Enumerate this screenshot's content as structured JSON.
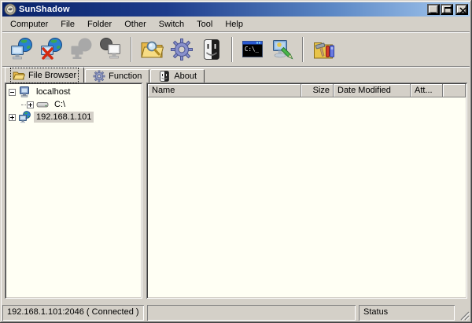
{
  "window": {
    "title": "SunShadow"
  },
  "titlebar_controls": [
    {
      "name": "minimize",
      "icon": "minimize-icon"
    },
    {
      "name": "maximize",
      "icon": "maximize-icon"
    },
    {
      "name": "close",
      "icon": "close-icon"
    }
  ],
  "menu": {
    "items": [
      "Computer",
      "File",
      "Folder",
      "Other",
      "Switch",
      "Tool",
      "Help"
    ]
  },
  "toolbar": {
    "buttons": [
      {
        "icon": "connect-icon"
      },
      {
        "icon": "disconnect-icon"
      },
      {
        "icon": "connect-disabled-icon",
        "disabled": true
      },
      {
        "icon": "computer-gray-icon",
        "disabled": true
      },
      {
        "icon": "separator"
      },
      {
        "icon": "folder-search-icon"
      },
      {
        "icon": "gear-icon"
      },
      {
        "icon": "finder-icon"
      },
      {
        "icon": "separator"
      },
      {
        "icon": "terminal-icon"
      },
      {
        "icon": "remote-edit-icon"
      },
      {
        "icon": "separator"
      },
      {
        "icon": "toolbox-icon"
      }
    ]
  },
  "tabs": [
    {
      "label": "File Browser",
      "icon": "folder-open-icon",
      "active": true
    },
    {
      "label": "Function",
      "icon": "gear-small-icon",
      "active": false
    },
    {
      "label": "About",
      "icon": "finder-small-icon",
      "active": false
    }
  ],
  "tree": {
    "items": [
      {
        "label": "localhost",
        "icon": "computer-icon",
        "expander": "minus",
        "level": 0,
        "selected": false
      },
      {
        "label": "C:\\",
        "icon": "drive-icon",
        "expander": "plus",
        "level": 1,
        "selected": false
      },
      {
        "label": "192.168.1.101",
        "icon": "remote-computer-icon",
        "expander": "plus",
        "level": 0,
        "selected": true
      }
    ]
  },
  "list": {
    "columns": [
      {
        "label": "Name",
        "width": 195,
        "align": "left"
      },
      {
        "label": "Size",
        "width": 41,
        "align": "right"
      },
      {
        "label": "Date Modified",
        "width": 98,
        "align": "left"
      },
      {
        "label": "Att...",
        "width": 41,
        "align": "left"
      }
    ],
    "rows": []
  },
  "statusbar": {
    "connection": "192.168.1.101:2046  ( Connected )",
    "message": "",
    "status": "Status"
  }
}
